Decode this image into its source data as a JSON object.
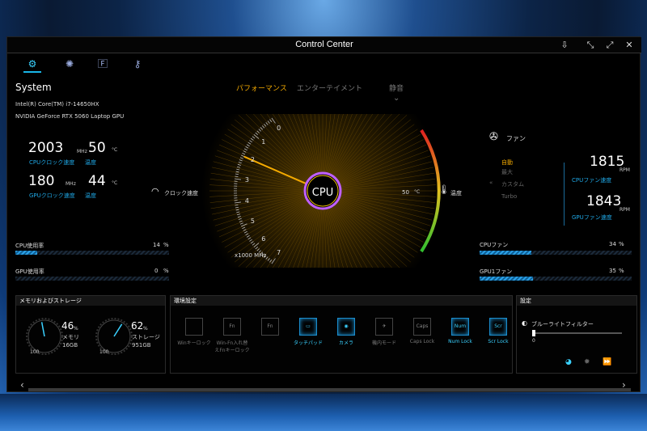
{
  "window": {
    "title": "Control Center"
  },
  "tabs": [
    "system-tab",
    "display-tab",
    "fn-tab",
    "key-tab"
  ],
  "system": {
    "heading": "System",
    "cpu_name": "Intel(R) Core(TM) i7-14650HX",
    "gpu_name": "NVIDIA GeForce RTX 5060 Laptop GPU",
    "cpu_clock": "2003",
    "cpu_clock_unit": "MHz",
    "cpu_clock_label": "CPUクロック速度",
    "cpu_temp": "50",
    "cpu_temp_unit": "°C",
    "cpu_temp_label": "温度",
    "gpu_clock": "180",
    "gpu_clock_unit": "MHz",
    "gpu_clock_label": "GPUクロック速度",
    "gpu_temp": "44",
    "gpu_temp_unit": "°C",
    "gpu_temp_label": "温度",
    "cpu_usage_label": "CPU使用率",
    "cpu_usage_value": "14",
    "cpu_usage": 14,
    "gpu_usage_label": "GPU使用率",
    "gpu_usage_value": "0",
    "gpu_usage": 0,
    "percent": "%"
  },
  "modes": {
    "performance": "パフォーマンス",
    "entertainment": "エンターテイメント",
    "silent": "静音"
  },
  "gauge": {
    "center": "CPU",
    "clock_label": "クロック速度",
    "unit": "x1000 MHz",
    "ticks": [
      "0",
      "1",
      "2",
      "3",
      "4",
      "5",
      "6",
      "7"
    ],
    "temp_value": "50",
    "temp_unit": "°C",
    "temp_label": "温度",
    "clock_value": 2.003
  },
  "fan": {
    "heading": "ファン",
    "modes": [
      "自動",
      "最大",
      "カスタム",
      "Turbo"
    ],
    "active_mode": "自動",
    "cpu_rpm": "1815",
    "cpu_rpm_label": "CPUファン速度",
    "gpu_rpm": "1843",
    "gpu_rpm_label": "GPUファン速度",
    "rpm_unit": "RPM",
    "cpu_fan_label": "CPUファン",
    "cpu_fan_value": "34",
    "cpu_fan": 34,
    "gpu_fan_label": "GPU1ファン",
    "gpu_fan_value": "35",
    "gpu_fan": 35,
    "percent": "%"
  },
  "memory": {
    "heading": "メモリおよびストレージ",
    "mem_percent": "46",
    "mem_label": "メモリ",
    "mem_size": "16GB",
    "mem_usage": 46,
    "sto_percent": "62",
    "sto_label": "ストレージ",
    "sto_size": "951GB",
    "sto_usage": 62,
    "gauge_min": "0",
    "gauge_max": "100",
    "percent": "%"
  },
  "env": {
    "heading": "環境設定",
    "items": [
      {
        "label": "Winキーロック",
        "key": "",
        "on": false
      },
      {
        "label": "Win-Fn入れ替えFnキーロック",
        "key": "Fn",
        "on": false
      },
      {
        "label": "",
        "key": "Fn",
        "on": false
      },
      {
        "label": "タッチパッド",
        "key": "▭",
        "on": true
      },
      {
        "label": "カメラ",
        "key": "◉",
        "on": true
      },
      {
        "label": "機内モード",
        "key": "✈",
        "on": false
      },
      {
        "label": "Caps Lock",
        "key": "Caps",
        "on": false
      },
      {
        "label": "Num Lock",
        "key": "Num",
        "on": true
      },
      {
        "label": "Scr Lock",
        "key": "Scr",
        "on": true
      }
    ]
  },
  "settings": {
    "heading": "設定",
    "bluelight_label": "ブルーライトフィルター",
    "bluelight_value": "0",
    "bluelight_min": "0"
  },
  "colors": {
    "accent": "#19b6e8",
    "gold": "#f2a900",
    "panel": "#000000"
  }
}
